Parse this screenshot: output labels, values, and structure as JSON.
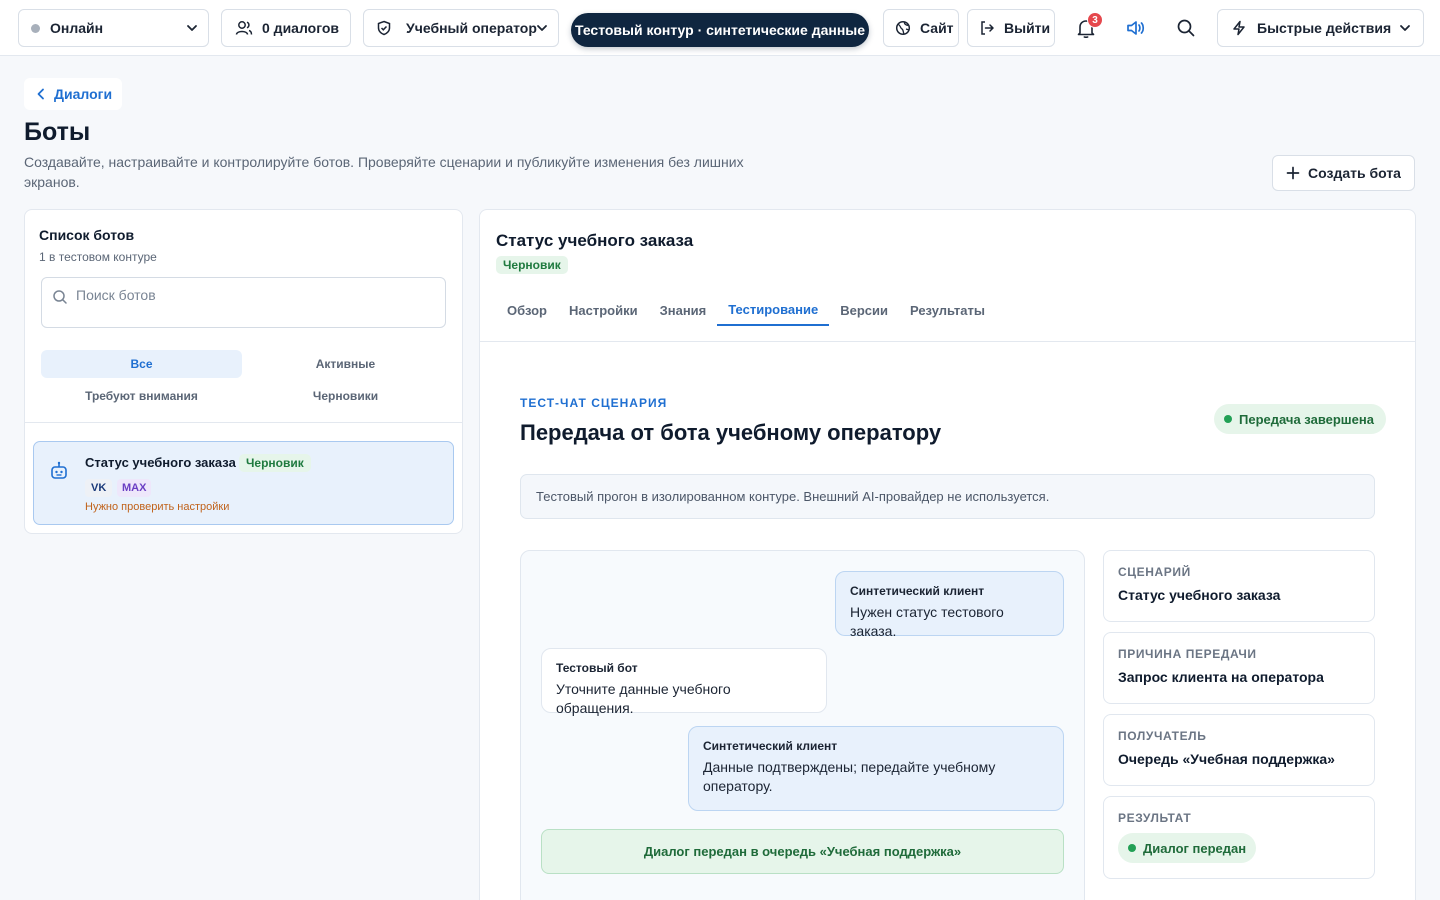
{
  "topbar": {
    "status": "Онлайн",
    "dialogs": "0 диалогов",
    "operator": "Учебный оператор",
    "environment": "Тестовый контур · синтетические данные",
    "site": "Сайт",
    "logout": "Выйти",
    "notifications_count": "3",
    "quick_actions": "Быстрые действия"
  },
  "header": {
    "back_label": "Диалоги",
    "title": "Боты",
    "subtitle": "Создавайте, настраивайте и контролируйте ботов. Проверяйте сценарии и публикуйте изменения без лишних экранов.",
    "create_label": "Создать бота"
  },
  "bot_list": {
    "title": "Список ботов",
    "count": "1 в тестовом контуре",
    "search_placeholder": "Поиск ботов",
    "filters": [
      "Все",
      "Активные",
      "Требуют внимания",
      "Черновики"
    ],
    "active_filter": "Все",
    "items": [
      {
        "name": "Статус учебного заказа",
        "status": "Черновик",
        "channels": [
          "VK",
          "MAX"
        ],
        "warning": "Нужно проверить настройки"
      }
    ]
  },
  "detail": {
    "title": "Статус учебного заказа",
    "status": "Черновик",
    "tabs": [
      "Обзор",
      "Настройки",
      "Знания",
      "Тестирование",
      "Версии",
      "Результаты"
    ],
    "active_tab": "Тестирование",
    "test": {
      "kicker": "ТЕСТ-ЧАТ СЦЕНАРИЯ",
      "title": "Передача от бота учебному оператору",
      "status": "Передача завершена",
      "notice": "Тестовый прогон в изолированном контуре. Внешний AI-провайдер не используется.",
      "messages": [
        {
          "author": "Синтетический клиент",
          "text": "Нужен статус тестового заказа."
        },
        {
          "author": "Тестовый бот",
          "text": "Уточните данные учебного обращения."
        },
        {
          "author": "Синтетический клиент",
          "text": "Данные подтверждены; передайте учебному оператору."
        }
      ],
      "handover": "Диалог передан в очередь «Учебная поддержка»",
      "info": [
        {
          "label": "СЦЕНАРИЙ",
          "value": "Статус учебного заказа"
        },
        {
          "label": "ПРИЧИНА ПЕРЕДАЧИ",
          "value": "Запрос клиента на оператора"
        },
        {
          "label": "ПОЛУЧАТЕЛЬ",
          "value": "Очередь «Учебная поддержка»"
        },
        {
          "label": "РЕЗУЛЬТАТ",
          "value": "Диалог передан"
        }
      ]
    }
  },
  "colors": {
    "accent": "#1f6fd1",
    "environment_bg": "#0f2640",
    "success": "#22a055",
    "warning": "#c0621a",
    "danger": "#e5484d"
  },
  "icons": [
    "chevron-down-icon",
    "users-icon",
    "shield-icon",
    "globe-icon",
    "logout-icon",
    "bell-icon",
    "speaker-icon",
    "search-icon",
    "lightning-icon",
    "chevron-left-icon",
    "plus-icon",
    "bot-icon"
  ]
}
